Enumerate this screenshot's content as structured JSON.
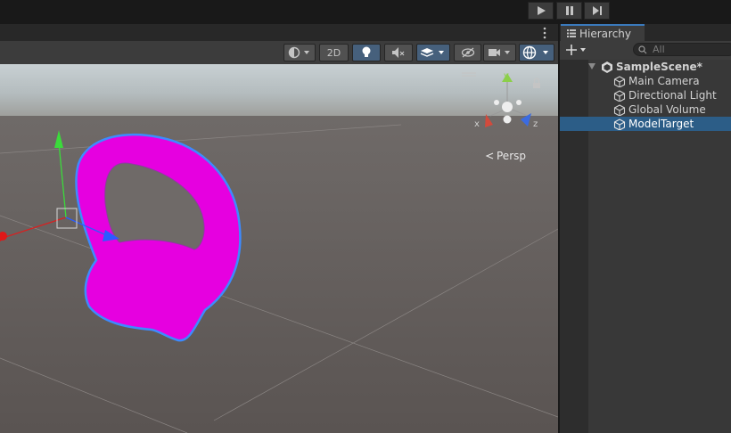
{
  "toolbar": {
    "mode_2d_label": "2D"
  },
  "scene": {
    "persp_label": "Persp",
    "gizmo_axes": {
      "x": "x",
      "y": "y",
      "z": "z"
    }
  },
  "hierarchy": {
    "tab_label": "Hierarchy",
    "search_placeholder": "All",
    "scene_name": "SampleScene*",
    "items": [
      {
        "label": "Main Camera"
      },
      {
        "label": "Directional Light"
      },
      {
        "label": "Global Volume"
      },
      {
        "label": "ModelTarget",
        "selected": true
      }
    ]
  },
  "colors": {
    "selection": "#2c5d87",
    "accent": "#3a79bb",
    "model": "#e600e0",
    "outline": "#3d8bff"
  },
  "icons": {
    "play": "play-icon",
    "pause": "pause-icon",
    "step": "step-icon",
    "more": "more-vertical-icon",
    "shading": "shading-mode-icon",
    "light": "lightbulb-icon",
    "audio": "audio-mute-icon",
    "fx": "effects-icon",
    "visibility": "scene-visibility-icon",
    "camera": "camera-icon",
    "gizmos": "gizmos-icon",
    "lock": "lock-icon",
    "hierarchy": "hierarchy-list-icon",
    "add": "plus-icon",
    "search": "search-icon",
    "unity": "unity-scene-icon",
    "gameobject": "cube-icon"
  }
}
